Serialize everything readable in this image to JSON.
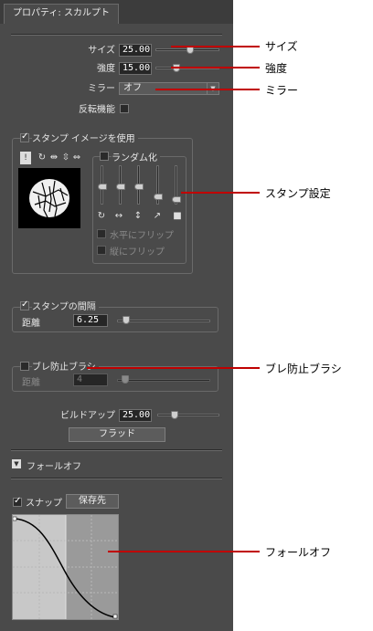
{
  "tab": {
    "label": "プロパティ: スカルプト"
  },
  "size": {
    "label": "サイズ",
    "value": "25.00",
    "slider": 0.55
  },
  "strength": {
    "label": "強度",
    "value": "15.00",
    "slider": 0.3
  },
  "mirror": {
    "label": "ミラー",
    "value": "オフ"
  },
  "invert": {
    "label": "反転機能"
  },
  "stamp": {
    "use_label": "スタンプ イメージを使用",
    "random_label": "ランダム化",
    "flip_h_label": "水平にフリップ",
    "flip_v_label": "縦にフリップ",
    "vsliders": [
      0.55,
      0.55,
      0.55,
      0.85,
      0.95
    ]
  },
  "spacing": {
    "label": "スタンプの間隔",
    "distance_label": "距離",
    "value": "6.25",
    "slider": 0.06
  },
  "lazy": {
    "label": "ブレ防止ブラシ",
    "distance_label": "距離",
    "value": "4",
    "slider": 0.05
  },
  "buildup": {
    "label": "ビルドアップ",
    "value": "25.00",
    "slider": 0.25
  },
  "flood": {
    "label": "フラッド"
  },
  "falloff": {
    "label": "フォールオフ"
  },
  "snap": {
    "label": "スナップ",
    "save_label": "保存先"
  },
  "callouts": {
    "size": "サイズ",
    "strength": "強度",
    "mirror": "ミラー",
    "stamp": "スタンプ設定",
    "lazy": "ブレ防止ブラシ",
    "falloff": "フォールオフ"
  },
  "colors": {
    "panel": "#4a4a4a",
    "callout": "#c00000"
  }
}
